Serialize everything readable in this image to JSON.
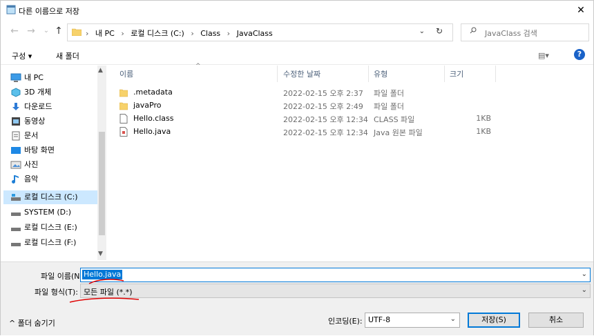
{
  "window": {
    "title": "다른 이름으로 저장",
    "close": "✕"
  },
  "nav": {
    "back": "←",
    "forward": "→",
    "recent": "⌄",
    "up": "↑",
    "breadcrumbs": [
      "내 PC",
      "로컬 디스크 (C:)",
      "Class",
      "JavaClass"
    ],
    "refresh": "↻",
    "search_placeholder": "JavaClass 검색"
  },
  "toolbar": {
    "organize": "구성 ▾",
    "new_folder": "새 폴더",
    "view": "▤▾",
    "help": "?"
  },
  "sidebar": {
    "items": [
      {
        "label": "내 PC",
        "icon": "pc-icon"
      },
      {
        "label": "3D 개체",
        "icon": "cube-icon"
      },
      {
        "label": "다운로드",
        "icon": "download-icon"
      },
      {
        "label": "동영상",
        "icon": "video-icon"
      },
      {
        "label": "문서",
        "icon": "document-icon"
      },
      {
        "label": "바탕 화면",
        "icon": "desktop-icon"
      },
      {
        "label": "사진",
        "icon": "picture-icon"
      },
      {
        "label": "음악",
        "icon": "music-icon"
      },
      {
        "label": "로컬 디스크 (C:)",
        "icon": "drive-icon",
        "selected": true
      },
      {
        "label": "SYSTEM (D:)",
        "icon": "drive-icon"
      },
      {
        "label": "로컬 디스크 (E:)",
        "icon": "drive-icon"
      },
      {
        "label": "로컬 디스크 (F:)",
        "icon": "drive-icon"
      }
    ]
  },
  "columns": {
    "name": "이름",
    "modified": "수정한 날짜",
    "type": "유형",
    "size": "크기"
  },
  "files": [
    {
      "name": ".metadata",
      "modified": "2022-02-15 오후 2:37",
      "type": "파일 폴더",
      "size": "",
      "icon": "folder-icon"
    },
    {
      "name": "javaPro",
      "modified": "2022-02-15 오후 2:49",
      "type": "파일 폴더",
      "size": "",
      "icon": "folder-icon"
    },
    {
      "name": "Hello.class",
      "modified": "2022-02-15 오후 12:34",
      "type": "CLASS 파일",
      "size": "1KB",
      "icon": "file-icon"
    },
    {
      "name": "Hello.java",
      "modified": "2022-02-15 오후 12:34",
      "type": "Java 원본 파일",
      "size": "1KB",
      "icon": "java-file-icon"
    }
  ],
  "form": {
    "filename_label": "파일 이름(N):",
    "filename_value": "Hello.java",
    "filetype_label": "파일 형식(T):",
    "filetype_value": "모든 파일 (*.*)",
    "hide_folders": "^ 폴더 숨기기",
    "encoding_label": "인코딩(E):",
    "encoding_value": "UTF-8",
    "save": "저장(S)",
    "cancel": "취소"
  },
  "colors": {
    "accent": "#0078d7",
    "selection": "#cce8ff",
    "annotation": "#e00000"
  }
}
